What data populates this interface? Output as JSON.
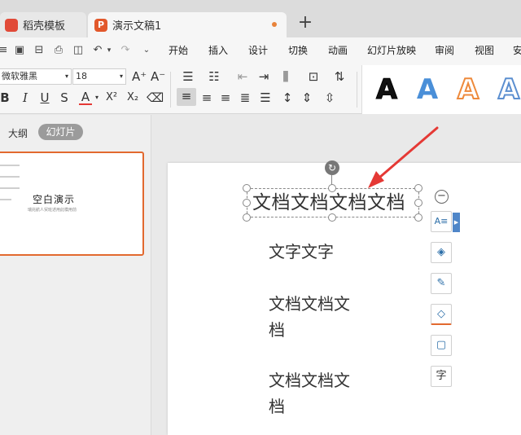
{
  "tabs": [
    {
      "label": "稻壳模板",
      "icon": "daoke-logo-icon"
    },
    {
      "label": "演示文稿1",
      "icon": "presentation-logo-icon",
      "logo_text": "P"
    }
  ],
  "new_tab": "+",
  "menu": [
    "开始",
    "插入",
    "设计",
    "切换",
    "动画",
    "幻灯片放映",
    "审阅",
    "视图",
    "安"
  ],
  "font": {
    "name": "微软雅黑",
    "size": "18"
  },
  "style_gallery": {
    "letters": [
      "A",
      "A",
      "A",
      "A"
    ],
    "colors": [
      "#111111",
      "#4a8fd8",
      "#ee8a3c",
      "#5c8fd0"
    ]
  },
  "left_panel": {
    "tab_outline": "大纲",
    "tab_slides": "幻灯片",
    "thumb_title": "空白演示",
    "thumb_subtitle": "瑞兆航人贸班述用此模用前"
  },
  "slide": {
    "title": "文档文档文档文档",
    "line1": "文字文字",
    "line2a": "文档文档文",
    "line2b": "档",
    "line3a": "文档文档文",
    "line3b": "档"
  },
  "side_tools": [
    "text-style-icon",
    "layers-icon",
    "brush-icon",
    "fill-icon",
    "border-icon",
    "char-format-icon"
  ],
  "char_tool_label": "字",
  "colors": {
    "accent": "#e2692f",
    "arrow": "#e53935",
    "tool_blue": "#2b6ea8"
  }
}
